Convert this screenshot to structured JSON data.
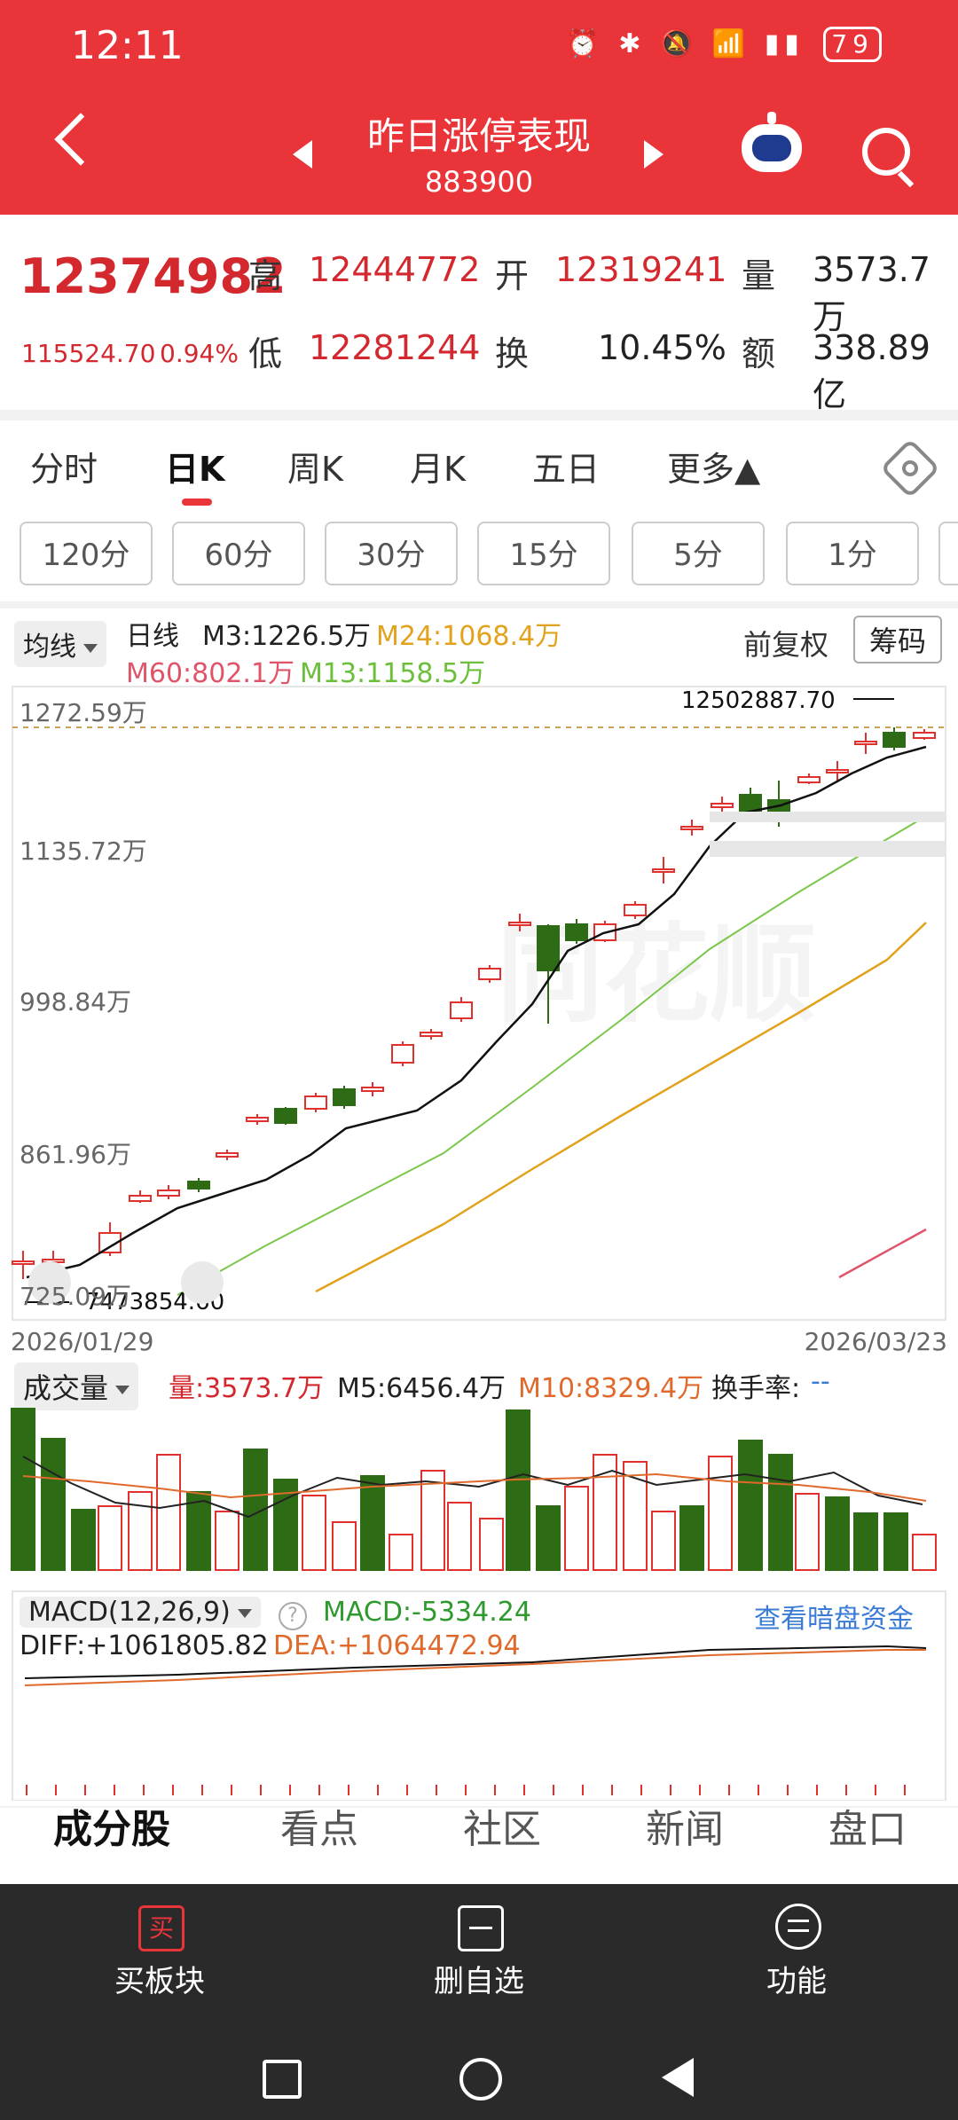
{
  "status_bar": {
    "time": "12:11",
    "battery": "79"
  },
  "header": {
    "title": "昨日涨停表现",
    "code": "883900"
  },
  "quote": {
    "price": "12374982",
    "change": "115524.70",
    "change_pct": "0.94%",
    "high_label": "高",
    "high": "12444772",
    "low_label": "低",
    "low": "12281244",
    "open_label": "开",
    "open": "12319241",
    "turnover_label": "换",
    "turnover": "10.45%",
    "volume_label": "量",
    "volume": "3573.7万",
    "amount_label": "额",
    "amount": "338.89亿"
  },
  "tabs": [
    "分时",
    "日K",
    "周K",
    "月K",
    "五日",
    "更多▲"
  ],
  "periods": [
    "120分",
    "60分",
    "30分",
    "15分",
    "5分",
    "1分"
  ],
  "kline": {
    "ma_select": "均线",
    "label_day": "日线",
    "m3": "M3:1226.5万",
    "m24": "M24:1068.4万",
    "m60": "M60:802.1万",
    "m13": "M13:1158.5万",
    "adjust": "前复权",
    "chips": "筹码",
    "y1": "1272.59万",
    "y2": "1135.72万",
    "y3": "998.84万",
    "y4": "861.96万",
    "y5": "725.09万",
    "max_label": "12502887.70",
    "min_label": "7473854.60",
    "date_start": "2026/01/29",
    "date_end": "2026/03/23",
    "colors": {
      "up": "#e0312f",
      "down": "#2e6b15",
      "ma5": "#111111",
      "ma13": "#7bc74b",
      "ma24": "#e2a21b",
      "ma60": "#e0546a"
    }
  },
  "volume_panel": {
    "select": "成交量",
    "vol": "量:3573.7万",
    "m5": "M5:6456.4万",
    "m10": "M10:8329.4万",
    "turnover": "换手率:",
    "turnover_val": "--"
  },
  "macd": {
    "select": "MACD(12,26,9)",
    "value": "MACD:-5334.24",
    "diff": "DIFF:+1061805.82",
    "dea": "DEA:+1064472.94",
    "link": "查看暗盘资金"
  },
  "bottom_tabs": [
    "成分股",
    "看点",
    "社区",
    "新闻",
    "盘口"
  ],
  "bottom_bar": {
    "buy": "买板块",
    "delete": "删自选",
    "func": "功能",
    "buy_icon": "买"
  }
}
